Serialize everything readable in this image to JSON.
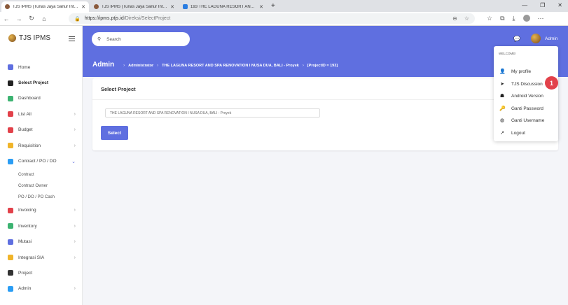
{
  "browser": {
    "tabs": [
      {
        "title": "TJS IPMS (Tunas Jaya Sanur Inte...",
        "active": true
      },
      {
        "title": "TJS IPMS (Tunas Jaya Sanur Inte...",
        "active": false
      },
      {
        "title": "193 THE LAGUNA RESORT AND...",
        "active": false
      }
    ],
    "url_host": "https://ipms.ptjs.id",
    "url_path": "/Direksi/SelectProject"
  },
  "app": {
    "logo_text": "TJS IPMS",
    "search_placeholder": "Search",
    "user_name": "Admin"
  },
  "sidebar": {
    "items": [
      {
        "label": "Home",
        "icon": "home-icon",
        "color": "#5f6fe0"
      },
      {
        "label": "Select Project",
        "icon": "plane-icon",
        "color": "#222222"
      },
      {
        "label": "Dashboard",
        "icon": "dashboard-icon",
        "color": "#3cb371"
      },
      {
        "label": "List All",
        "icon": "list-icon",
        "color": "#e2414a"
      },
      {
        "label": "Budget",
        "icon": "budget-icon",
        "color": "#e2414a"
      },
      {
        "label": "Requisition",
        "icon": "hand-icon",
        "color": "#f0b429"
      },
      {
        "label": "Contract / PO / DO",
        "icon": "contract-icon",
        "color": "#2a9df4"
      },
      {
        "label": "Invoicing",
        "icon": "invoice-icon",
        "color": "#e2414a"
      },
      {
        "label": "Inventory",
        "icon": "inventory-icon",
        "color": "#3cb371"
      },
      {
        "label": "Mutasi",
        "icon": "mutasi-icon",
        "color": "#5f6fe0"
      },
      {
        "label": "Integrasi SIA",
        "icon": "sia-icon",
        "color": "#f0b429"
      },
      {
        "label": "Project",
        "icon": "project-icon",
        "color": "#333333"
      },
      {
        "label": "Admin",
        "icon": "user-icon",
        "color": "#2a9df4"
      }
    ],
    "subitems": [
      "Contract",
      "Contract Owner",
      "PO / DO / PO Cash"
    ]
  },
  "breadcrumb": {
    "title": "Admin",
    "role": "Administrator",
    "project": "THE LAGUNA RESORT AND SPA RENOVATION I NUSA DUA, BALI - Proyek",
    "project_id": "[ProjectID = 193]"
  },
  "card": {
    "title": "Select Project",
    "selected_project": "THE LAGUNA RESORT AND SPA RENOVATION I NUSA DUA, BALI - Proyek",
    "button_label": "Select"
  },
  "user_menu": {
    "welcome": "WELCOME!",
    "items": [
      "My profile",
      "TJS Discussion",
      "Android Version",
      "Ganti Password",
      "Ganti Username",
      "Logout"
    ]
  },
  "annotation": {
    "badge": "1",
    "color": "#e2414a"
  },
  "theme": {
    "accent": "#5f6fe0"
  }
}
